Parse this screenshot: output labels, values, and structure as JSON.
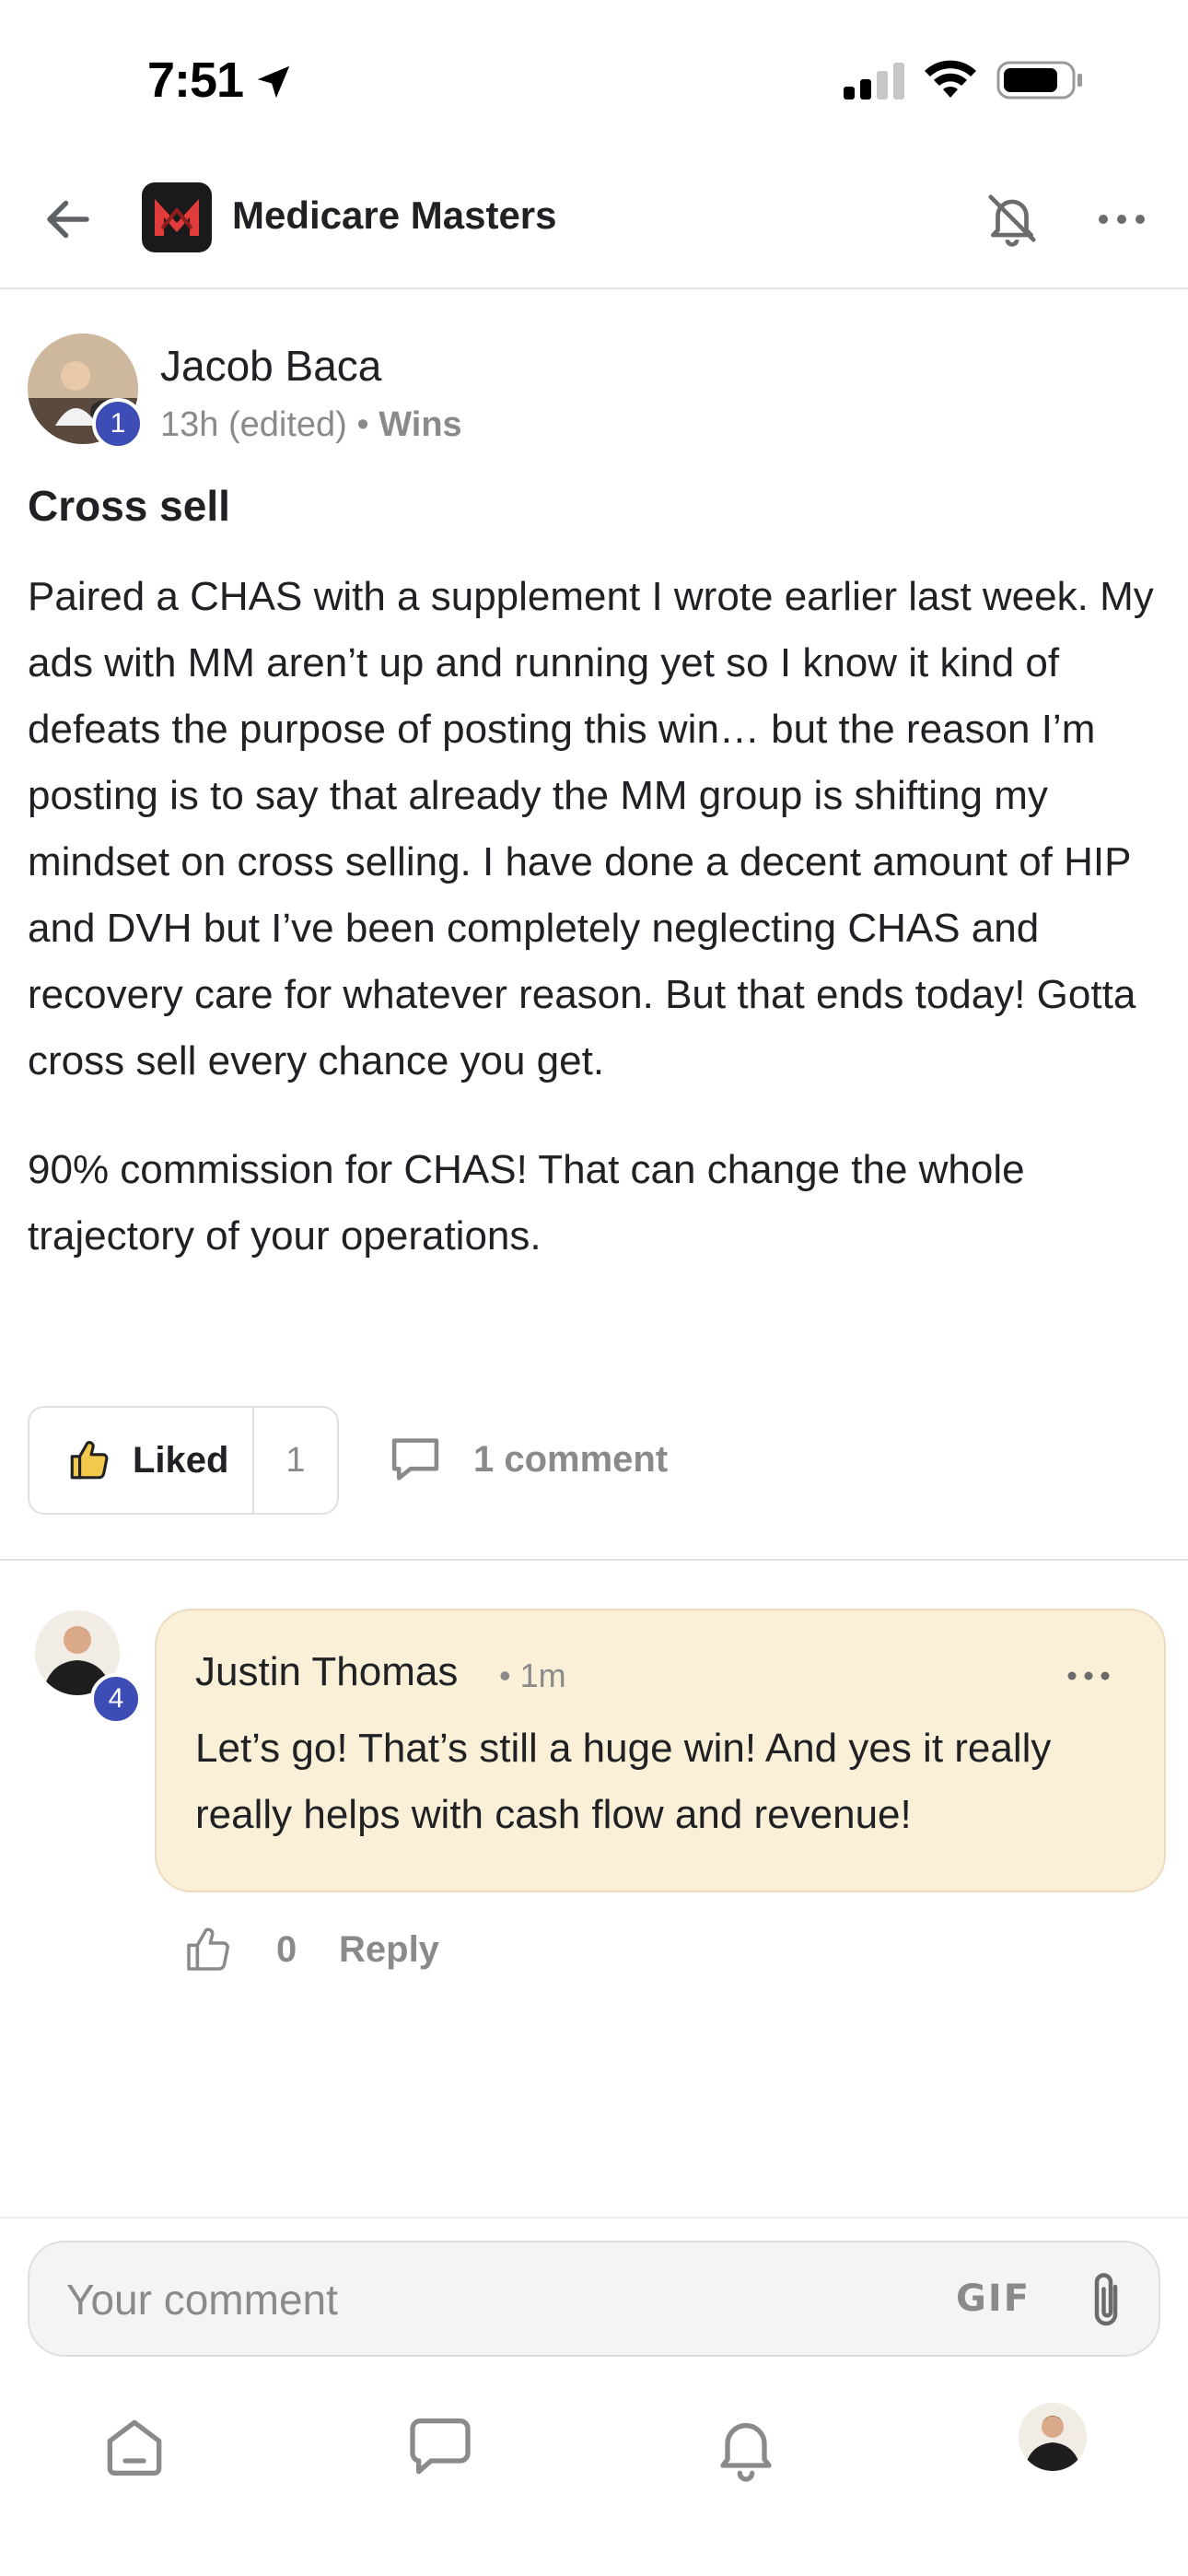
{
  "status_bar": {
    "time": "7:51",
    "icons": [
      "location-arrow-icon",
      "cellular-signal-icon",
      "wifi-icon",
      "battery-icon"
    ]
  },
  "header": {
    "group_name": "Medicare Masters",
    "icons": [
      "back-arrow-icon",
      "bell-off-icon",
      "more-horizontal-icon"
    ],
    "logo_colors": {
      "background": "#1a1a1a",
      "mark": "#e23b3b"
    }
  },
  "post": {
    "author": "Jacob Baca",
    "author_level": "1",
    "time": "13h (edited)",
    "separator": "•",
    "category": "Wins",
    "title": "Cross sell",
    "paragraphs": [
      "Paired a CHAS with a supplement I wrote earlier last week. My ads with MM aren’t up and running yet so I know it kind of defeats the purpose of posting this win… but the reason I’m posting is to say that already the MM group is shifting my mindset on cross selling. I have done a decent amount of HIP and DVH but I’ve been completely neglecting CHAS and recovery care for whatever reason. But that ends today! Gotta cross sell every chance you get.",
      "90% commission for CHAS! That can change the whole trajectory of your operations."
    ],
    "like_label": "Liked",
    "like_count": "1",
    "comment_count_label": "1 comment"
  },
  "comment": {
    "author": "Justin Thomas",
    "author_level": "4",
    "separator": "•",
    "time": "1m",
    "text": "Let’s go! That’s still a huge win! And yes it really really helps with cash flow and revenue!",
    "like_count": "0",
    "reply_label": "Reply",
    "bubble_color": "#faf0d7"
  },
  "composer": {
    "placeholder": "Your comment",
    "gif_label": "GIF"
  },
  "tabbar": {
    "tabs": [
      "home-icon",
      "chat-icon",
      "notifications-icon",
      "profile-avatar"
    ]
  },
  "colors": {
    "level_badge": "#3e4cb5",
    "like_thumb": "#f2c94c",
    "muted_text": "#8a8a8a"
  }
}
